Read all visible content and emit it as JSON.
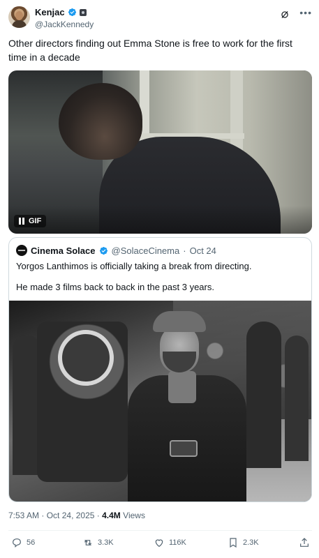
{
  "author": {
    "display_name": "Kenjac",
    "handle": "@JackKennedy"
  },
  "tweet": {
    "text": "Other directors finding out Emma Stone is free to work for the first time in a decade",
    "media_badge": "GIF"
  },
  "quote": {
    "display_name": "Cinema Solace",
    "handle": "@SolaceCinema",
    "separator": "·",
    "date": "Oct 24",
    "line1": "Yorgos Lanthimos is officially taking a break from directing.",
    "line2": "He made 3 films back to back in the past 3 years."
  },
  "meta": {
    "time": "7:53 AM",
    "separator": "·",
    "date": "Oct 24, 2025",
    "separator2": "·",
    "views_count": "4.4M",
    "views_label": "Views"
  },
  "actions": {
    "replies": "56",
    "reposts": "3.3K",
    "likes": "116K",
    "bookmarks": "2.3K"
  },
  "colors": {
    "verified_blue": "#1d9bf0",
    "text_primary": "#0f1419",
    "text_secondary": "#536471",
    "border": "#cfd9de"
  },
  "icons": {
    "header": [
      "verified-badge-icon",
      "affiliate-badge-icon",
      "grok-icon",
      "more-icon"
    ],
    "actions": [
      "reply-icon",
      "repost-icon",
      "like-icon",
      "bookmark-icon",
      "share-icon"
    ]
  }
}
